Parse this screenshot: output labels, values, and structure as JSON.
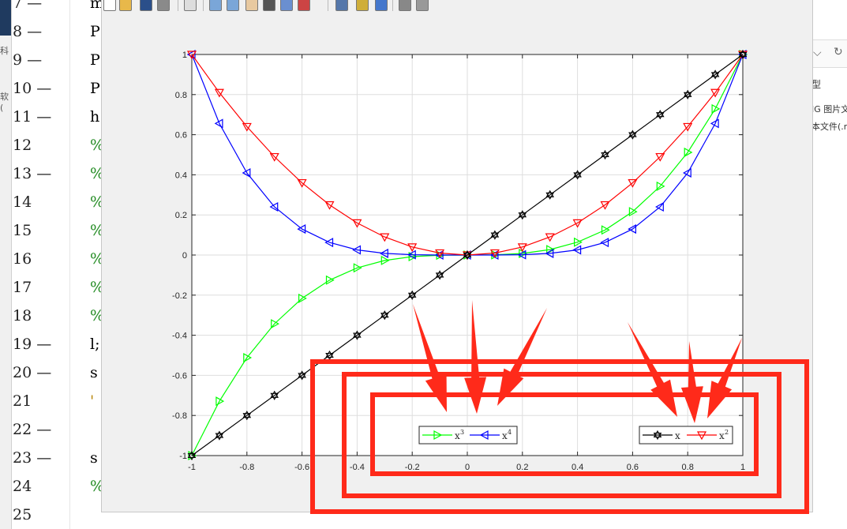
{
  "editor": {
    "line_numbers": [
      "7 —",
      "8 —",
      "9 —",
      "10 —",
      "11 —",
      "12",
      "13 —",
      "14",
      "15",
      "16",
      "17",
      "18",
      "19 —",
      "20 —",
      "21",
      "22 —",
      "23 —",
      "24",
      "25"
    ],
    "code_lines": [
      {
        "text": "m",
        "color": "#000000"
      },
      {
        "text": "P:",
        "color": "#000000"
      },
      {
        "text": "P:",
        "color": "#000000"
      },
      {
        "text": "P:",
        "color": "#000000"
      },
      {
        "text": "h",
        "color": "#000000"
      },
      {
        "text": "%",
        "color": "#228b22"
      },
      {
        "text": "%",
        "color": "#228b22"
      },
      {
        "text": "%",
        "color": "#228b22"
      },
      {
        "text": "%",
        "color": "#228b22"
      },
      {
        "text": "%",
        "color": "#228b22"
      },
      {
        "text": "%",
        "color": "#228b22"
      },
      {
        "text": "%",
        "color": "#228b22"
      },
      {
        "text": "l;",
        "color": "#000000"
      },
      {
        "text": "s",
        "color": "#000000"
      },
      {
        "text": "'",
        "color": "#b8860b"
      },
      {
        "text": "",
        "color": "#000000"
      },
      {
        "text": "s",
        "color": "#000000"
      },
      {
        "text": "%",
        "color": "#228b22"
      },
      {
        "text": "",
        "color": "#000000"
      }
    ],
    "left_strip_labels": [
      "科",
      "软("
    ]
  },
  "right_panel": {
    "lines": [
      "型",
      "IG 图片文",
      "本文件(.m"
    ],
    "icons": [
      "chevron-down-icon",
      "refresh-icon"
    ]
  },
  "toolbar": {
    "icons": [
      "new-figure-icon",
      "open-icon",
      "save-icon",
      "print-icon",
      "pointer-icon",
      "zoom-in-icon",
      "zoom-out-icon",
      "pan-icon",
      "rotate-icon",
      "data-cursor-icon",
      "brush-icon",
      "link-plot-icon",
      "colorbar-icon",
      "legend-icon",
      "hide-plot-tools-icon",
      "show-plot-tools-icon"
    ]
  },
  "annotations": {
    "arrow_color": "#ff2a1a",
    "rect_color": "#ff2a1a"
  },
  "chart_data": {
    "type": "line",
    "title": "",
    "xlabel": "",
    "ylabel": "",
    "xlim": [
      -1,
      1
    ],
    "ylim": [
      -1,
      1
    ],
    "grid": true,
    "x_tick_labels": [
      "-1",
      "-0.8",
      "-0.6",
      "-0.4",
      "-0.2",
      "0",
      "0.2",
      "0.4",
      "0.6",
      "0.8",
      "1"
    ],
    "y_tick_labels": [
      "-1",
      "-0.8",
      "-0.6",
      "-0.4",
      "-0.2",
      "0",
      "0.2",
      "0.4",
      "0.6",
      "0.8",
      "1"
    ],
    "x": [
      -1,
      -0.9,
      -0.8,
      -0.7,
      -0.6,
      -0.5,
      -0.4,
      -0.3,
      -0.2,
      -0.1,
      0,
      0.1,
      0.2,
      0.3,
      0.4,
      0.5,
      0.6,
      0.7,
      0.8,
      0.9,
      1
    ],
    "series": [
      {
        "name": "x",
        "color": "#000000",
        "marker": "hexagram",
        "values": [
          -1,
          -0.9,
          -0.8,
          -0.7,
          -0.6,
          -0.5,
          -0.4,
          -0.3,
          -0.2,
          -0.1,
          0,
          0.1,
          0.2,
          0.3,
          0.4,
          0.5,
          0.6,
          0.7,
          0.8,
          0.9,
          1
        ]
      },
      {
        "name": "x2",
        "color": "#ff0000",
        "marker": "triangle-down",
        "values": [
          1,
          0.81,
          0.64,
          0.49,
          0.36,
          0.25,
          0.16,
          0.09,
          0.04,
          0.01,
          0,
          0.01,
          0.04,
          0.09,
          0.16,
          0.25,
          0.36,
          0.49,
          0.64,
          0.81,
          1
        ]
      },
      {
        "name": "x3",
        "color": "#00ff00",
        "marker": "triangle-right",
        "values": [
          -1,
          -0.729,
          -0.512,
          -0.343,
          -0.216,
          -0.125,
          -0.064,
          -0.027,
          -0.008,
          -0.001,
          0,
          0.001,
          0.008,
          0.027,
          0.064,
          0.125,
          0.216,
          0.343,
          0.512,
          0.729,
          1
        ]
      },
      {
        "name": "x4",
        "color": "#0000ff",
        "marker": "triangle-left",
        "values": [
          1,
          0.6561,
          0.4096,
          0.2401,
          0.1296,
          0.0625,
          0.0256,
          0.0081,
          0.0016,
          0.0001,
          0,
          0.0001,
          0.0016,
          0.0081,
          0.0256,
          0.0625,
          0.1296,
          0.2401,
          0.4096,
          0.6561,
          1
        ]
      }
    ],
    "legends": [
      {
        "position": "bottom-center",
        "entries": [
          {
            "series": 2,
            "label": "x",
            "sup": "3"
          },
          {
            "series": 3,
            "label": "x",
            "sup": "4"
          }
        ]
      },
      {
        "position": "bottom-right",
        "entries": [
          {
            "series": 0,
            "label": "x",
            "sup": ""
          },
          {
            "series": 1,
            "label": "x",
            "sup": "2"
          }
        ]
      }
    ]
  }
}
